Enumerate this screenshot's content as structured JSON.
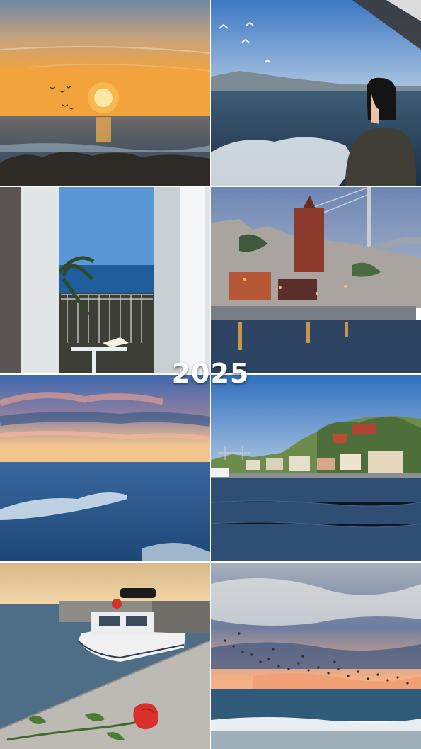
{
  "overlay": {
    "year_title": "2025"
  },
  "tiles": [
    {
      "scene": "sunset-over-sea-with-rocks-and-birds"
    },
    {
      "scene": "ferry-deck-woman-in-hijab-seagulls"
    },
    {
      "scene": "balcony-window-sea-view-with-palm"
    },
    {
      "scene": "waterfront-city-bridge-evening-lights"
    },
    {
      "scene": "pastel-sky-over-waves"
    },
    {
      "scene": "hillside-village-on-strait-with-bridge"
    },
    {
      "scene": "moored-boat-at-pier-with-red-rose"
    },
    {
      "scene": "flock-of-birds-over-sunset-beach"
    }
  ],
  "colors": {
    "sky_sunset": "#f0a33c",
    "sea_blue": "#27557e",
    "pastel_pink": "#f2b7a3",
    "rose_red": "#d8302a"
  }
}
